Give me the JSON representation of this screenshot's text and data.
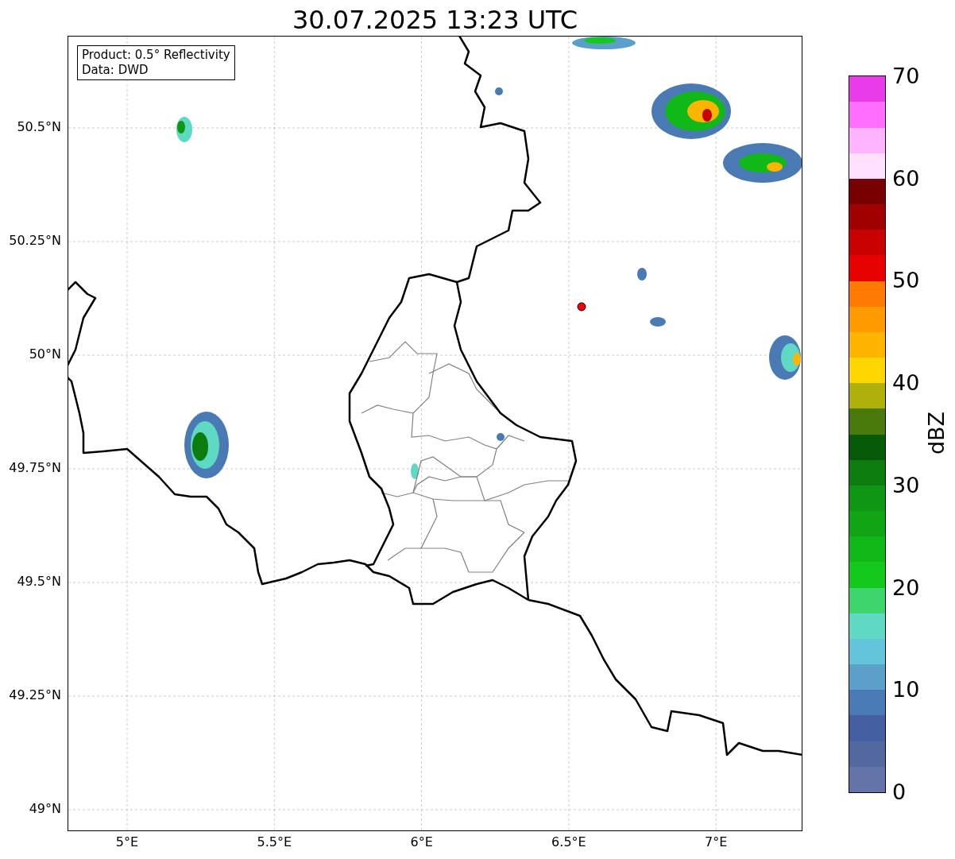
{
  "title": "30.07.2025 13:23 UTC",
  "info_box": [
    "Product: 0.5° Reflectivity",
    "Data: DWD"
  ],
  "map": {
    "lat_ticks": [
      "50.5°N",
      "50.25°N",
      "50°N",
      "49.75°N",
      "49.5°N",
      "49.25°N",
      "49°N"
    ],
    "lon_ticks": [
      "5°E",
      "5.5°E",
      "6°E",
      "6.5°E",
      "7°E"
    ]
  },
  "colorbar": {
    "label": "dBZ",
    "ticks": [
      "70",
      "60",
      "50",
      "40",
      "30",
      "20",
      "10",
      "0"
    ],
    "bins": [
      {
        "color": "#6473a8"
      },
      {
        "color": "#5468a0"
      },
      {
        "color": "#4560a0"
      },
      {
        "color": "#4a7ab4"
      },
      {
        "color": "#5aa0c8"
      },
      {
        "color": "#64c4dc"
      },
      {
        "color": "#5fd8c4"
      },
      {
        "color": "#3cd66c"
      },
      {
        "color": "#14c81c"
      },
      {
        "color": "#10b818"
      },
      {
        "color": "#0fa514"
      },
      {
        "color": "#0f9612"
      },
      {
        "color": "#0c7c0e"
      },
      {
        "color": "#065a08"
      },
      {
        "color": "#4a7a0a"
      },
      {
        "color": "#b0b00a"
      },
      {
        "color": "#ffd700"
      },
      {
        "color": "#ffb400"
      },
      {
        "color": "#ff9a00"
      },
      {
        "color": "#ff7a00"
      },
      {
        "color": "#e60000"
      },
      {
        "color": "#c80000"
      },
      {
        "color": "#a00000"
      },
      {
        "color": "#780000"
      },
      {
        "color": "#ffe0ff"
      },
      {
        "color": "#ffb4ff"
      },
      {
        "color": "#ff6eff"
      },
      {
        "color": "#e83ce8"
      }
    ]
  }
}
